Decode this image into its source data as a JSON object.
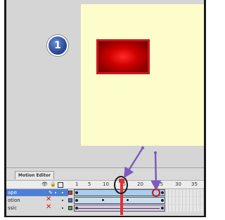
{
  "step": {
    "number": "1"
  },
  "timeline": {
    "tab_label": "Motion Editor",
    "ticks": [
      "1",
      "5",
      "10",
      "15",
      "20",
      "25",
      "30",
      "35"
    ],
    "layers": [
      {
        "name": "ape",
        "color": "#e83030",
        "selected": true
      },
      {
        "name": "otion",
        "color": "#4a6ee0",
        "selected": false
      },
      {
        "name": "ssic",
        "color": "#3fae3f",
        "selected": false
      }
    ]
  },
  "colors": {
    "stage": "#fdfccb",
    "shape_border": "#c8181c",
    "playhead": "#e53030",
    "annotation_arrow": "#7d5bbd"
  }
}
